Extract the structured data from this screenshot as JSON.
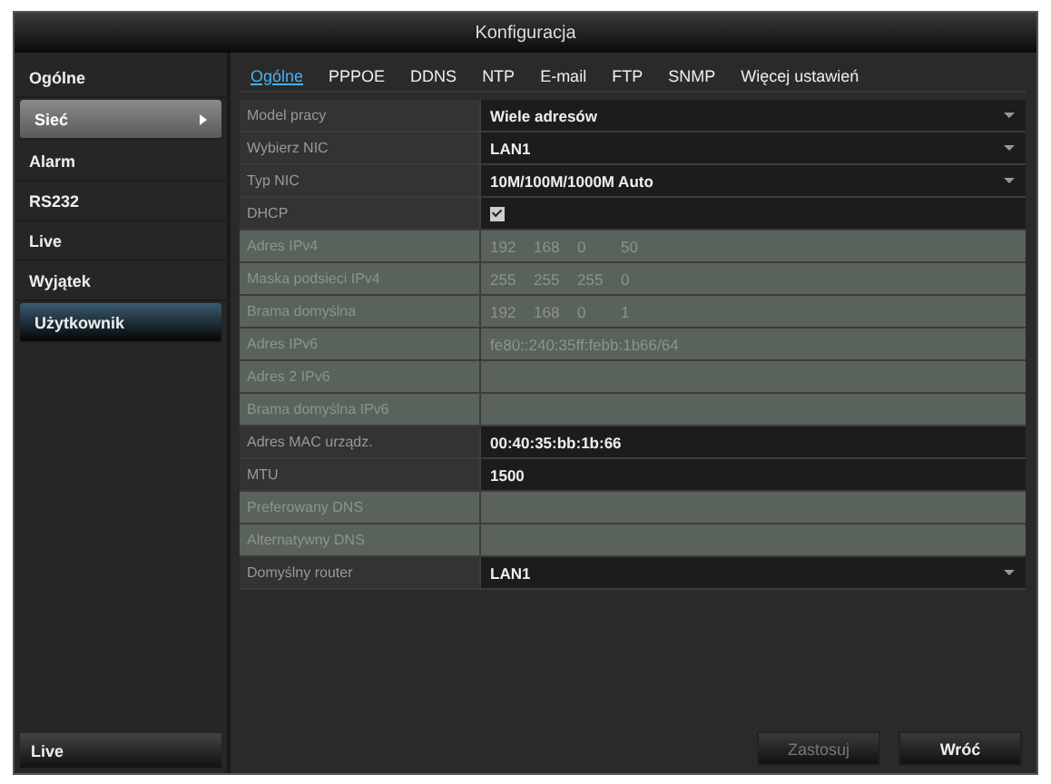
{
  "window": {
    "title": "Konfiguracja"
  },
  "sidebar": {
    "items": [
      {
        "label": "Ogólne",
        "selected": false
      },
      {
        "label": "Sieć",
        "selected": true
      },
      {
        "label": "Alarm",
        "selected": false
      },
      {
        "label": "RS232",
        "selected": false
      },
      {
        "label": "Live",
        "selected": false
      },
      {
        "label": "Wyjątek",
        "selected": false
      },
      {
        "label": "Użytkownik",
        "selected": false,
        "highlighted": true
      }
    ],
    "bottom_button": "Live"
  },
  "tabs": [
    {
      "label": "Ogólne",
      "selected": true
    },
    {
      "label": "PPPOE",
      "selected": false
    },
    {
      "label": "DDNS",
      "selected": false
    },
    {
      "label": "NTP",
      "selected": false
    },
    {
      "label": "E-mail",
      "selected": false
    },
    {
      "label": "FTP",
      "selected": false
    },
    {
      "label": "SNMP",
      "selected": false
    },
    {
      "label": "Więcej ustawień",
      "selected": false
    }
  ],
  "rows": [
    {
      "label": "Model pracy",
      "kind": "select",
      "value": "Wiele adresów",
      "disabled": false
    },
    {
      "label": "Wybierz NIC",
      "kind": "select",
      "value": "LAN1",
      "disabled": false
    },
    {
      "label": "Typ NIC",
      "kind": "select",
      "value": "10M/100M/1000M Auto",
      "disabled": false
    },
    {
      "label": "DHCP",
      "kind": "checkbox",
      "checked": true,
      "disabled": false
    },
    {
      "label": "Adres IPv4",
      "kind": "ip",
      "parts": [
        "192",
        "168",
        "0",
        "50"
      ],
      "disabled": true
    },
    {
      "label": "Maska podsieci IPv4",
      "kind": "ip",
      "parts": [
        "255",
        "255",
        "255",
        "0"
      ],
      "disabled": true
    },
    {
      "label": "Brama domyślna",
      "kind": "ip",
      "parts": [
        "192",
        "168",
        "0",
        "1"
      ],
      "disabled": true
    },
    {
      "label": "Adres IPv6",
      "kind": "text",
      "value": "fe80::240:35ff:febb:1b66/64",
      "disabled": true
    },
    {
      "label": "Adres 2 IPv6",
      "kind": "text",
      "disabled": true
    },
    {
      "label": "Brama domyślna IPv6",
      "kind": "text",
      "disabled": true
    },
    {
      "label": "Adres MAC urządz.",
      "kind": "text",
      "value": "00:40:35:bb:1b:66",
      "disabled": false
    },
    {
      "label": "MTU",
      "kind": "text",
      "value": "1500",
      "disabled": false
    },
    {
      "label": "Preferowany DNS",
      "kind": "text",
      "disabled": true
    },
    {
      "label": "Alternatywny DNS",
      "kind": "text",
      "disabled": true
    },
    {
      "label": "Domyślny router",
      "kind": "select",
      "value": "LAN1",
      "disabled": false
    }
  ],
  "buttons": [
    {
      "label": "Zastosuj",
      "disabled": true
    },
    {
      "label": "Wróć",
      "disabled": false
    }
  ]
}
